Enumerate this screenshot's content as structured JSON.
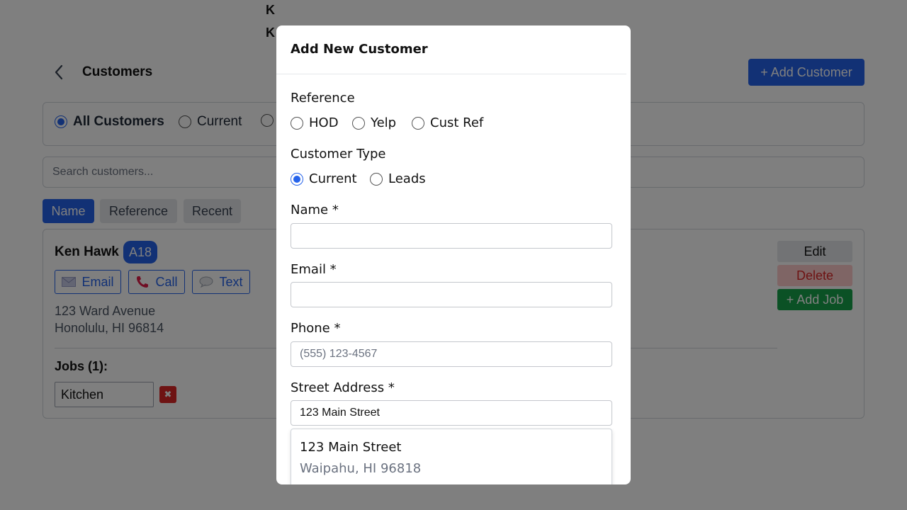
{
  "background": {
    "top_letters": [
      "K",
      "K"
    ],
    "header": {
      "title": "Customers",
      "add_button": "+ Add Customer"
    },
    "filters": [
      {
        "label": "All Customers",
        "selected": true
      },
      {
        "label": "Current",
        "selected": false
      },
      {
        "label": "",
        "selected": false
      }
    ],
    "search": {
      "placeholder": "Search customers..."
    },
    "sort_tabs": [
      {
        "label": "Name",
        "active": true
      },
      {
        "label": "Reference",
        "active": false
      },
      {
        "label": "Recent",
        "active": false
      }
    ],
    "customer": {
      "name": "Ken Hawk",
      "reference_badge": "A18",
      "contact_buttons": [
        {
          "label": "Email",
          "icon": "envelope-icon"
        },
        {
          "label": "Call",
          "icon": "phone-icon"
        },
        {
          "label": "Text",
          "icon": "speech-bubble-icon"
        }
      ],
      "address_line1": "123 Ward Avenue",
      "address_line2": "Honolulu, HI 96814",
      "jobs_label": "Jobs (1):",
      "jobs": [
        {
          "value": "Kitchen"
        }
      ],
      "actions": {
        "edit": "Edit",
        "delete": "Delete",
        "add_job": "+ Add Job"
      }
    }
  },
  "modal": {
    "title": "Add New Customer",
    "reference": {
      "label": "Reference",
      "options": [
        {
          "label": "HOD",
          "selected": false
        },
        {
          "label": "Yelp",
          "selected": false
        },
        {
          "label": "Cust Ref",
          "selected": false
        }
      ]
    },
    "customer_type": {
      "label": "Customer Type",
      "options": [
        {
          "label": "Current",
          "selected": true
        },
        {
          "label": "Leads",
          "selected": false
        }
      ]
    },
    "fields": {
      "name": {
        "label": "Name *",
        "value": "",
        "placeholder": ""
      },
      "email": {
        "label": "Email *",
        "value": "",
        "placeholder": ""
      },
      "phone": {
        "label": "Phone *",
        "value": "",
        "placeholder": "(555) 123-4567"
      },
      "street": {
        "label": "Street Address *",
        "value": "123 Main Street",
        "placeholder": ""
      }
    },
    "suggestion": {
      "street": "123 Main Street",
      "city": "Waipahu, HI 96818"
    }
  },
  "colors": {
    "primary": "#2563eb",
    "danger": "#dc2626",
    "success": "#16a34a",
    "overlay": "rgba(0,0,0,0.5)"
  }
}
